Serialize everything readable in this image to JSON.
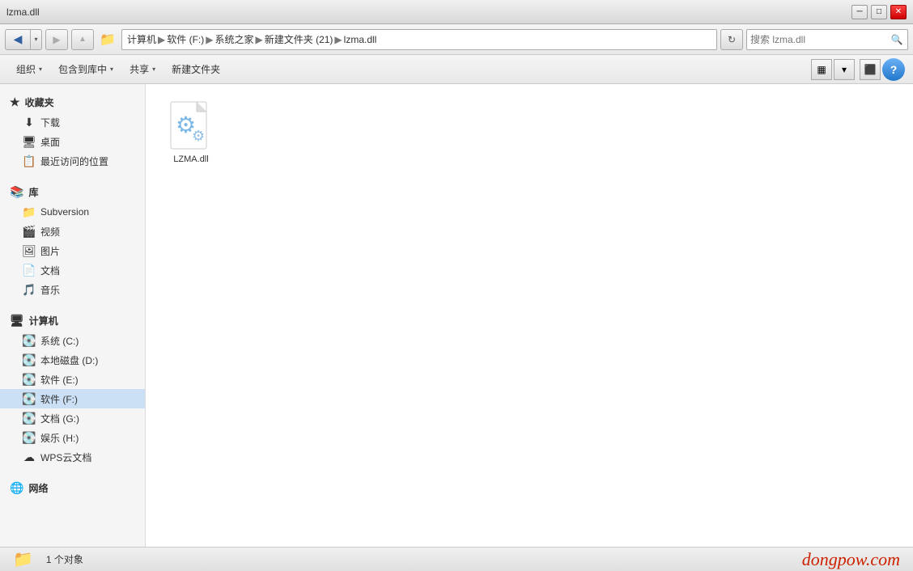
{
  "window": {
    "title": "lzma.dll",
    "minimize": "─",
    "maximize": "□",
    "close": "✕"
  },
  "addressbar": {
    "path_parts": [
      "计算机",
      "软件 (F:)",
      "系统之家",
      "新建文件夹 (21)",
      "lzma.dll"
    ],
    "search_placeholder": "搜索 lzma.dll"
  },
  "toolbar": {
    "organize": "组织",
    "include_in_library": "包含到库中",
    "share": "共享",
    "new_folder": "新建文件夹",
    "help": "?"
  },
  "sidebar": {
    "favorites_label": "收藏夹",
    "download": "下载",
    "desktop": "桌面",
    "recent": "最近访问的位置",
    "library_label": "库",
    "subversion": "Subversion",
    "video": "视频",
    "images": "图片",
    "documents": "文档",
    "music": "音乐",
    "computer_label": "计算机",
    "system_c": "系统 (C:)",
    "local_d": "本地磁盘 (D:)",
    "software_e": "软件 (E:)",
    "software_f": "软件 (F:)",
    "document_g": "文档 (G:)",
    "entertainment_h": "娱乐 (H:)",
    "wps_cloud": "WPS云文档",
    "network_label": "网络"
  },
  "files": [
    {
      "name": "LZMA.dll",
      "type": "dll"
    }
  ],
  "statusbar": {
    "count": "1 个对象",
    "watermark": "dongpow.com"
  }
}
